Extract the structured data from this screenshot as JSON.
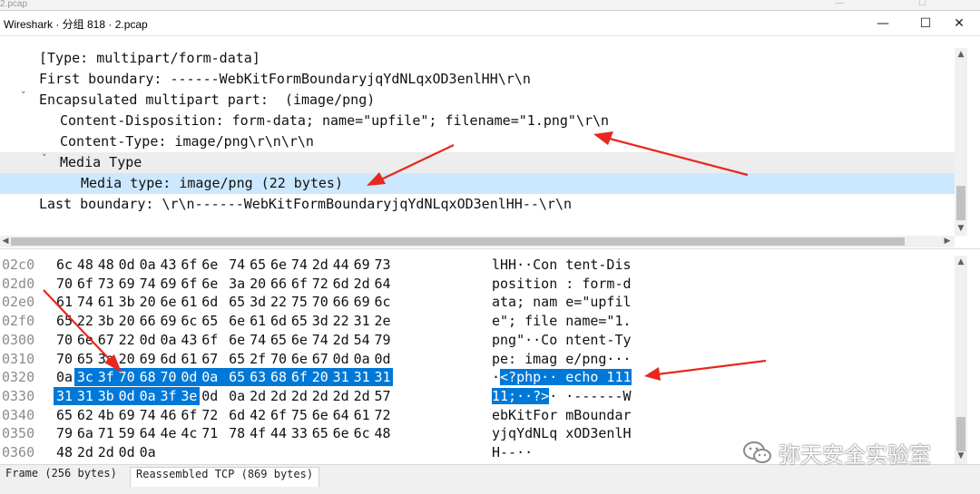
{
  "window": {
    "behind_title": "2.pcap",
    "title": "Wireshark · 分组 818 · 2.pcap",
    "minimize": "—",
    "maximize": "☐",
    "close": "✕"
  },
  "tree": {
    "lines": [
      {
        "text": "[Type: multipart/form-data]",
        "indent": 43,
        "expander": ""
      },
      {
        "text": "First boundary: ------WebKitFormBoundaryjqYdNLqxOD3enlHH\\r\\n",
        "indent": 43,
        "expander": ""
      },
      {
        "text": "Encapsulated multipart part:  (image/png)",
        "indent": 43,
        "expander": "˅"
      },
      {
        "text": "Content-Disposition: form-data; name=\"upfile\"; filename=\"1.png\"\\r\\n",
        "indent": 66,
        "expander": ""
      },
      {
        "text": "Content-Type: image/png\\r\\n\\r\\n",
        "indent": 66,
        "expander": ""
      },
      {
        "text": "Media Type",
        "indent": 66,
        "expander": "˅",
        "shaded": true
      },
      {
        "text": "Media type: image/png (22 bytes)",
        "indent": 89,
        "expander": "",
        "selected": true
      },
      {
        "text": "Last boundary: \\r\\n------WebKitFormBoundaryjqYdNLqxOD3enlHH--\\r\\n",
        "indent": 43,
        "expander": ""
      }
    ]
  },
  "bytes": {
    "rows": [
      {
        "offset": "02c0",
        "hex": [
          "6c",
          "48",
          "48",
          "0d",
          "0a",
          "43",
          "6f",
          "6e",
          "74",
          "65",
          "6e",
          "74",
          "2d",
          "44",
          "69",
          "73"
        ],
        "ascii": "lHH··Con tent-Dis"
      },
      {
        "offset": "02d0",
        "hex": [
          "70",
          "6f",
          "73",
          "69",
          "74",
          "69",
          "6f",
          "6e",
          "3a",
          "20",
          "66",
          "6f",
          "72",
          "6d",
          "2d",
          "64"
        ],
        "ascii": "position : form-d"
      },
      {
        "offset": "02e0",
        "hex": [
          "61",
          "74",
          "61",
          "3b",
          "20",
          "6e",
          "61",
          "6d",
          "65",
          "3d",
          "22",
          "75",
          "70",
          "66",
          "69",
          "6c"
        ],
        "ascii": "ata; nam e=\"upfil"
      },
      {
        "offset": "02f0",
        "hex": [
          "65",
          "22",
          "3b",
          "20",
          "66",
          "69",
          "6c",
          "65",
          "6e",
          "61",
          "6d",
          "65",
          "3d",
          "22",
          "31",
          "2e"
        ],
        "ascii": "e\"; file name=\"1."
      },
      {
        "offset": "0300",
        "hex": [
          "70",
          "6e",
          "67",
          "22",
          "0d",
          "0a",
          "43",
          "6f",
          "6e",
          "74",
          "65",
          "6e",
          "74",
          "2d",
          "54",
          "79"
        ],
        "ascii": "png\"··Co ntent-Ty"
      },
      {
        "offset": "0310",
        "hex": [
          "70",
          "65",
          "3a",
          "20",
          "69",
          "6d",
          "61",
          "67",
          "65",
          "2f",
          "70",
          "6e",
          "67",
          "0d",
          "0a",
          "0d"
        ],
        "ascii": "pe: imag e/png···"
      },
      {
        "offset": "0320",
        "hex": [
          "0a",
          "3c",
          "3f",
          "70",
          "68",
          "70",
          "0d",
          "0a",
          "65",
          "63",
          "68",
          "6f",
          "20",
          "31",
          "31",
          "31"
        ],
        "ascii": "·<?php·· echo 111",
        "hl_hex": [
          1,
          15
        ],
        "hl_ascii": [
          1,
          17
        ]
      },
      {
        "offset": "0330",
        "hex": [
          "31",
          "31",
          "3b",
          "0d",
          "0a",
          "3f",
          "3e",
          "0d",
          "0a",
          "2d",
          "2d",
          "2d",
          "2d",
          "2d",
          "2d",
          "57"
        ],
        "ascii": "11;··?>· ·------W",
        "hl_hex": [
          0,
          6
        ],
        "hl_ascii": [
          0,
          7
        ]
      },
      {
        "offset": "0340",
        "hex": [
          "65",
          "62",
          "4b",
          "69",
          "74",
          "46",
          "6f",
          "72",
          "6d",
          "42",
          "6f",
          "75",
          "6e",
          "64",
          "61",
          "72"
        ],
        "ascii": "ebKitFor mBoundar"
      },
      {
        "offset": "0350",
        "hex": [
          "79",
          "6a",
          "71",
          "59",
          "64",
          "4e",
          "4c",
          "71",
          "78",
          "4f",
          "44",
          "33",
          "65",
          "6e",
          "6c",
          "48"
        ],
        "ascii": "yjqYdNLq xOD3enlH"
      },
      {
        "offset": "0360",
        "hex": [
          "48",
          "2d",
          "2d",
          "0d",
          "0a"
        ],
        "ascii": "H--··"
      }
    ]
  },
  "status": {
    "tabs": [
      "Frame (256 bytes)",
      "Reassembled TCP (869 bytes)"
    ],
    "active_tab": 1
  },
  "watermark": {
    "text": "弥天安全实验室",
    "icon": "wechat-icon"
  },
  "colors": {
    "selection": "#cce8ff",
    "highlight": "#0078d7",
    "annotation_arrow": "#e8271f"
  }
}
